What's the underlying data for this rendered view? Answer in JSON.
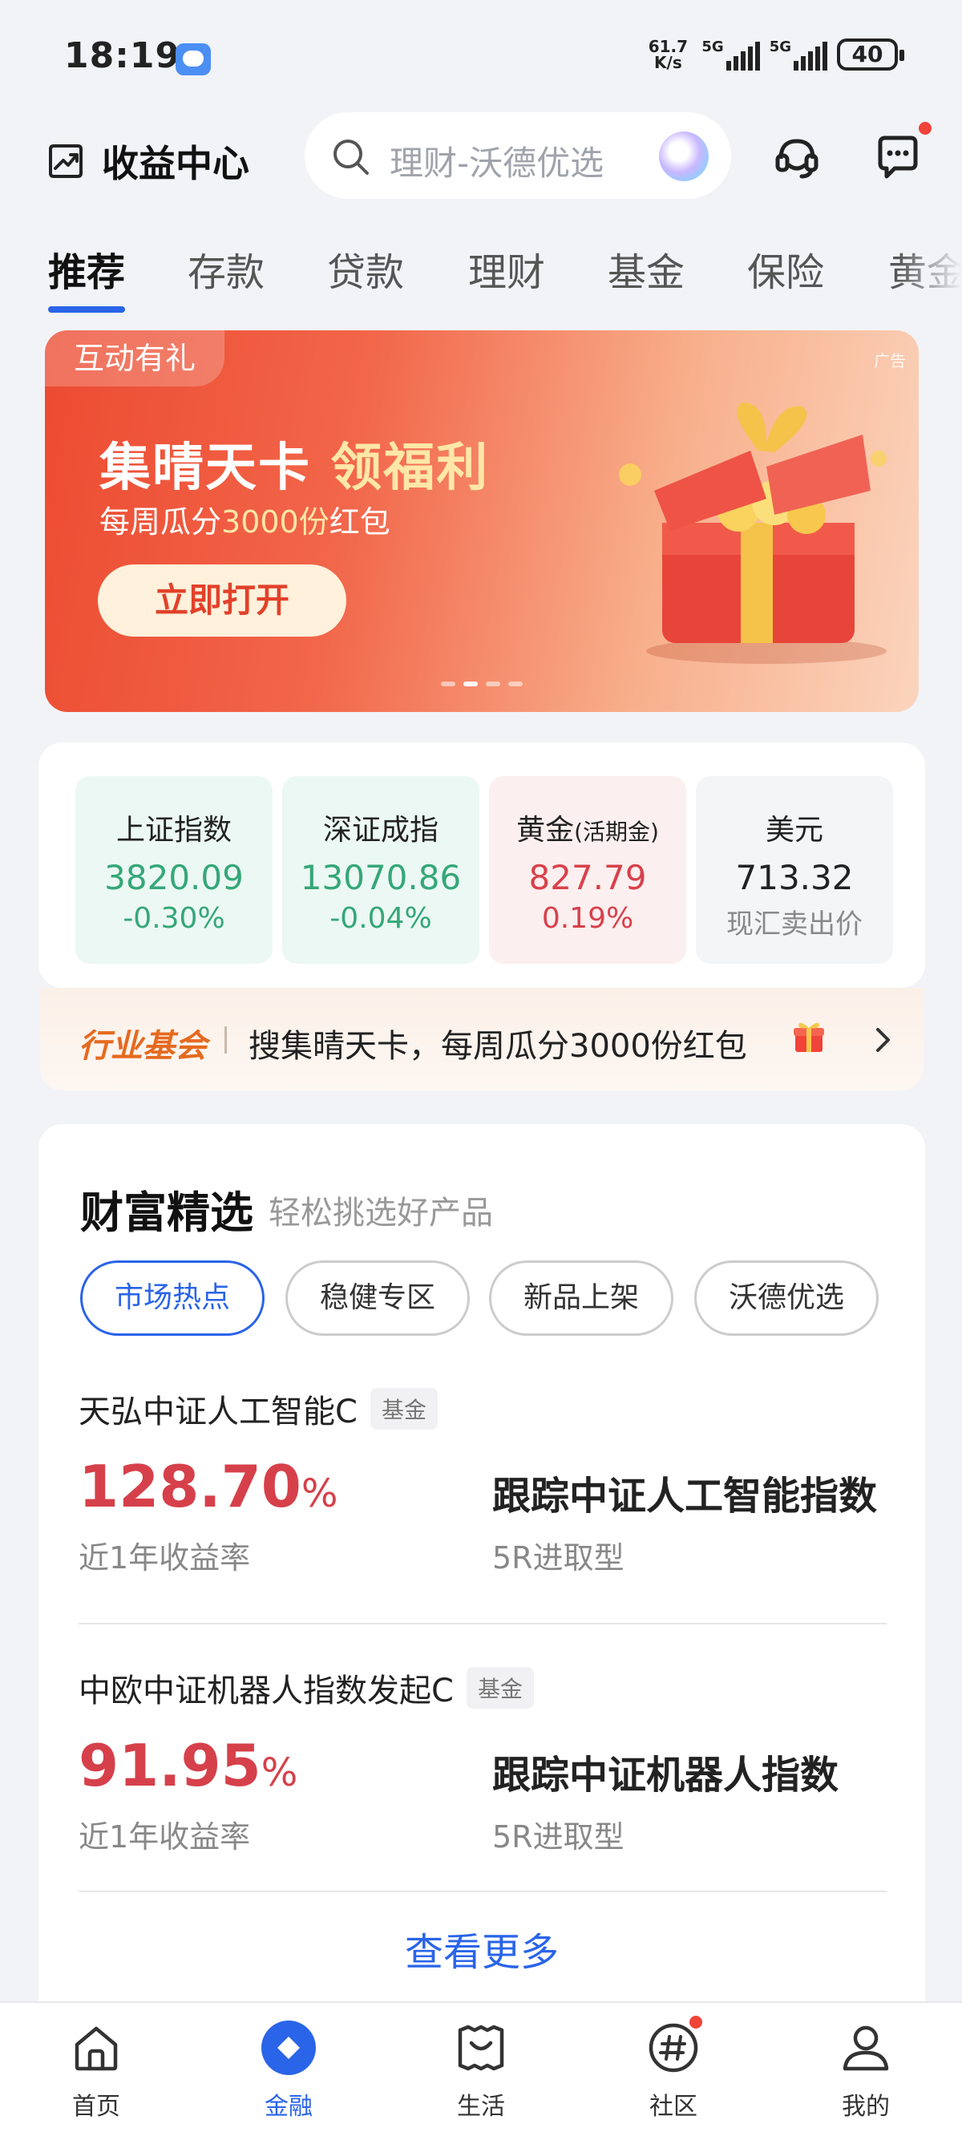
{
  "status_bar": {
    "time": "18:19",
    "net_speed_top": "61.7",
    "net_speed_bottom": "K/s",
    "signal1_label": "5G",
    "signal2_label": "5G",
    "battery": "40"
  },
  "header": {
    "title": "收益中心",
    "search_placeholder": "理财-沃德优选"
  },
  "tabs": [
    {
      "label": "推荐",
      "active": true
    },
    {
      "label": "存款"
    },
    {
      "label": "贷款"
    },
    {
      "label": "理财"
    },
    {
      "label": "基金"
    },
    {
      "label": "保险"
    },
    {
      "label": "黄金"
    }
  ],
  "banner": {
    "tag": "互动有礼",
    "ad_label": "广告",
    "title_main": "集晴天卡 ",
    "title_highlight": "领福利",
    "subtitle_pre": "每周瓜分",
    "subtitle_highlight": "3000份",
    "subtitle_post": "红包",
    "button": "立即打开",
    "page_count": 4,
    "active_page": 2
  },
  "market": [
    {
      "name": "上证指数",
      "value": "3820.09",
      "change": "-0.30%",
      "tone": "green"
    },
    {
      "name": "深证成指",
      "value": "13070.86",
      "change": "-0.04%",
      "tone": "green"
    },
    {
      "name": "黄金",
      "name_small": "(活期金)",
      "value": "827.79",
      "change": "0.19%",
      "tone": "red"
    },
    {
      "name": "美元",
      "value": "713.32",
      "change": "现汇卖出价",
      "tone": "gray"
    }
  ],
  "notice": {
    "tag": "行业基会",
    "text": "搜集晴天卡，每周瓜分3000份红包"
  },
  "wealth": {
    "title": "财富精选",
    "subtitle": "轻松挑选好产品",
    "chips": [
      "市场热点",
      "稳健专区",
      "新品上架",
      "沃德优选"
    ],
    "active_chip": 0,
    "funds": [
      {
        "name": "天弘中证人工智能C",
        "badge": "基金",
        "rate": "128.70",
        "rate_unit": "%",
        "rate_label": "近1年收益率",
        "desc": "跟踪中证人工智能指数",
        "risk": "5R进取型"
      },
      {
        "name": "中欧中证机器人指数发起C",
        "badge": "基金",
        "rate": "91.95",
        "rate_unit": "%",
        "rate_label": "近1年收益率",
        "desc": "跟踪中证机器人指数",
        "risk": "5R进取型"
      }
    ],
    "more": "查看更多"
  },
  "tabbar": [
    {
      "label": "首页",
      "icon": "home-icon"
    },
    {
      "label": "金融",
      "icon": "finance-diamond-icon",
      "active": true
    },
    {
      "label": "生活",
      "icon": "life-ticket-icon"
    },
    {
      "label": "社区",
      "icon": "community-hash-icon",
      "badge": true
    },
    {
      "label": "我的",
      "icon": "profile-icon"
    }
  ],
  "colors": {
    "accent_blue": "#2a64e8",
    "up_red": "#d6404a",
    "down_green": "#35a77a",
    "notice_orange": "#e56a20"
  }
}
